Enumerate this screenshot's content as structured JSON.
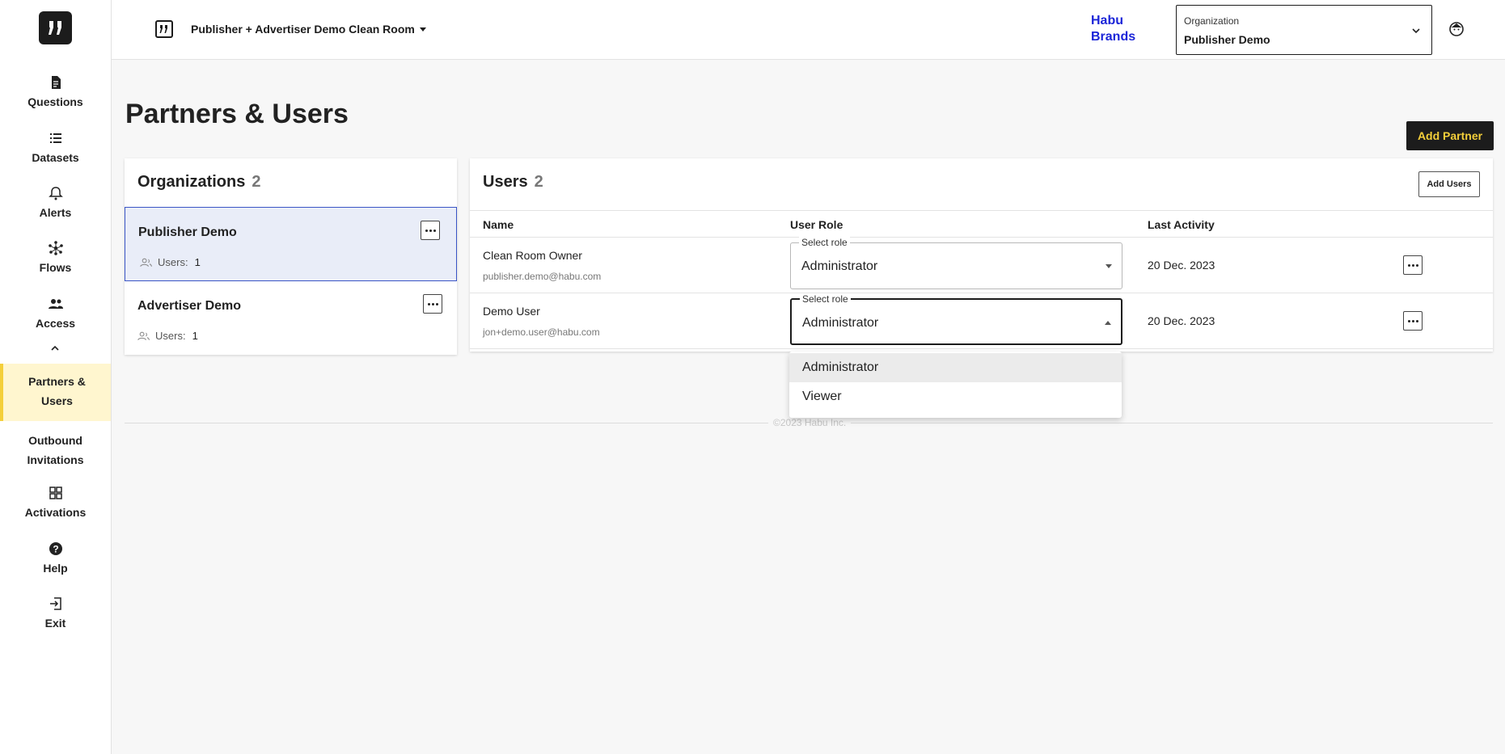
{
  "sidebar": {
    "items": [
      {
        "label": "Questions",
        "icon": "document-icon"
      },
      {
        "label": "Datasets",
        "icon": "list-icon"
      },
      {
        "label": "Alerts",
        "icon": "bell-icon"
      },
      {
        "label": "Flows",
        "icon": "network-icon"
      },
      {
        "label": "Access",
        "icon": "people-icon"
      },
      {
        "label": "Partners & Users"
      },
      {
        "label": "Outbound Invitations"
      },
      {
        "label": "Activations",
        "icon": "grid-icon"
      },
      {
        "label": "Help",
        "icon": "help-icon"
      },
      {
        "label": "Exit",
        "icon": "exit-icon"
      }
    ]
  },
  "header": {
    "clean_room_title": "Publisher + Advertiser Demo Clean Room",
    "brand": "Habu Brands",
    "org_select": {
      "label": "Organization",
      "value": "Publisher Demo"
    }
  },
  "page": {
    "title": "Partners & Users",
    "add_partner_label": "Add Partner"
  },
  "organizations": {
    "title": "Organizations",
    "count": "2",
    "users_label": "Users:",
    "items": [
      {
        "name": "Publisher Demo",
        "users": "1",
        "selected": true
      },
      {
        "name": "Advertiser Demo",
        "users": "1",
        "selected": false
      }
    ]
  },
  "users": {
    "title": "Users",
    "count": "2",
    "add_users_label": "Add Users",
    "columns": [
      "Name",
      "User Role",
      "Last Activity"
    ],
    "role_legend": "Select role",
    "rows": [
      {
        "name": "Clean Room Owner",
        "email": "publisher.demo@habu.com",
        "role": "Administrator",
        "last_activity": "20 Dec. 2023"
      },
      {
        "name": "Demo User",
        "email": "jon+demo.user@habu.com",
        "role": "Administrator",
        "last_activity": "20 Dec. 2023"
      }
    ]
  },
  "role_dropdown": {
    "options": [
      "Administrator",
      "Viewer"
    ]
  },
  "footer": {
    "text": "©2023 Habu Inc."
  },
  "colors": {
    "accent": "#f4cf3a",
    "brand": "#1b25d8",
    "selected_bg": "#e9edf8"
  }
}
